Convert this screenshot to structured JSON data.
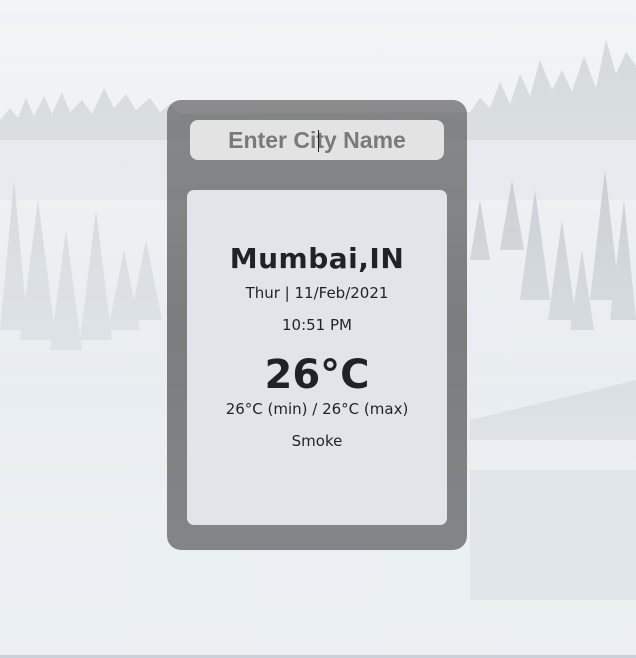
{
  "search": {
    "placeholder": "Enter City Name",
    "value": ""
  },
  "weather": {
    "city": "Mumbai,IN",
    "date": "Thur | 11/Feb/2021",
    "time": "10:51 PM",
    "temperature": "26°C",
    "min_max": "26°C (min) / 26°C (max)",
    "condition": "Smoke"
  },
  "colors": {
    "panel": "#5f5f5f",
    "card": "#e8ecf0",
    "text": "#1f2328",
    "input_bg": "#f0f0f0"
  }
}
